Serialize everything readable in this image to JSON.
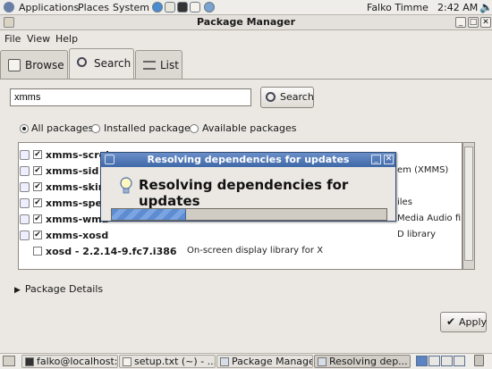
{
  "top_panel": {
    "menus": [
      "Applications",
      "Places",
      "System"
    ],
    "user": "Falko Timme",
    "clock": "2:42 AM",
    "icons": [
      "globe-icon",
      "mail-icon",
      "terminal-icon",
      "editor-icon",
      "network-icon",
      "sound-icon"
    ]
  },
  "window": {
    "title": "Package Manager",
    "menus": [
      "File",
      "View",
      "Help"
    ],
    "tabs": [
      {
        "label": "Browse",
        "icon": "browse-icon",
        "active": false
      },
      {
        "label": "Search",
        "icon": "magnifier-icon",
        "active": true
      },
      {
        "label": "List",
        "icon": "list-icon",
        "active": false
      }
    ]
  },
  "search": {
    "value": "xmms",
    "button_label": "Search"
  },
  "filters": {
    "options": [
      "All packages",
      "Installed packages",
      "Available packages"
    ],
    "selected": "All packages"
  },
  "packages": [
    {
      "name": "xmms-scrob",
      "desc": "",
      "checked": true
    },
    {
      "name": "xmms-sid -",
      "desc": "em (XMMS)",
      "checked": true
    },
    {
      "name": "xmms-skins",
      "desc": "",
      "checked": true
    },
    {
      "name": "xmms-speez",
      "desc": "iles",
      "checked": true
    },
    {
      "name": "xmms-wma",
      "desc": "Media Audio files",
      "checked": true
    },
    {
      "name": "xmms-xosd",
      "desc": "D library",
      "checked": true
    },
    {
      "name": "xosd - 2.2.14-9.fc7.i386",
      "desc": "On-screen display library for X",
      "checked": false
    }
  ],
  "details": {
    "label": "Package Details"
  },
  "apply": {
    "label": "Apply"
  },
  "dialog": {
    "title": "Resolving dependencies for updates",
    "heading": "Resolving dependencies for updates",
    "progress": 0.27
  },
  "taskbar": {
    "tasks": [
      {
        "label": "falko@localhost:...",
        "active": false
      },
      {
        "label": "setup.txt (~) - ...",
        "active": false
      },
      {
        "label": "Package Manager",
        "active": false
      },
      {
        "label": "Resolving dep...",
        "active": true
      }
    ]
  }
}
